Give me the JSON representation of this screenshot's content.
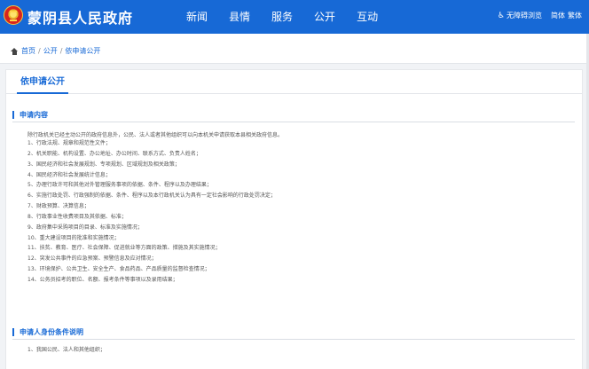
{
  "header": {
    "site_title": "蒙阴县人民政府",
    "nav": [
      "新闻",
      "县情",
      "服务",
      "公开",
      "互动"
    ],
    "accessibility_label": "无障碍浏览",
    "lang_simplified": "简体",
    "lang_traditional": "繁体",
    "color": "#1769d6"
  },
  "breadcrumb": {
    "items": [
      "首页",
      "公开",
      "依申请公开"
    ],
    "separator": "/"
  },
  "tab": {
    "active_label": "依申请公开"
  },
  "sections": {
    "content": {
      "title": "申请内容",
      "intro": "除行政机关已经主动公开的政府信息外，公民、法人或者其他组织可以向本机关申请获取本县相关政府信息。",
      "items": [
        "1、行政法规、规章和规范性文件；",
        "2、机关职能、机构设置、办公地址、办公时间、联系方式、负责人姓名；",
        "3、国民经济和社会发展规划、专项规划、区域规划及相关政策；",
        "4、国民经济和社会发展统计信息；",
        "5、办理行政许可和其他对外管理服务事项的依据、条件、程序以及办理结果；",
        "6、实施行政处罚、行政强制的依据、条件、程序以及本行政机关认为具有一定社会影响的行政处罚决定；",
        "7、财政预算、决算信息；",
        "8、行政事业性收费项目及其依据、标准；",
        "9、政府集中采购项目的目录、标准及实施情况；",
        "10、重大建设项目的批准和实施情况；",
        "11、扶贫、教育、医疗、社会保障、促进就业等方面的政策、措施及其实施情况；",
        "12、突发公共事件的应急预案、预警信息及应对情况；",
        "13、环境保护、公共卫生、安全生产、食品药品、产品质量的监督检查情况；",
        "14、公务员招考的职位、名额、报考条件等事项以及录用结果；"
      ]
    },
    "identity": {
      "title": "申请人身份条件说明",
      "items": [
        "1、我国公民、法人和其他组织；"
      ]
    }
  }
}
